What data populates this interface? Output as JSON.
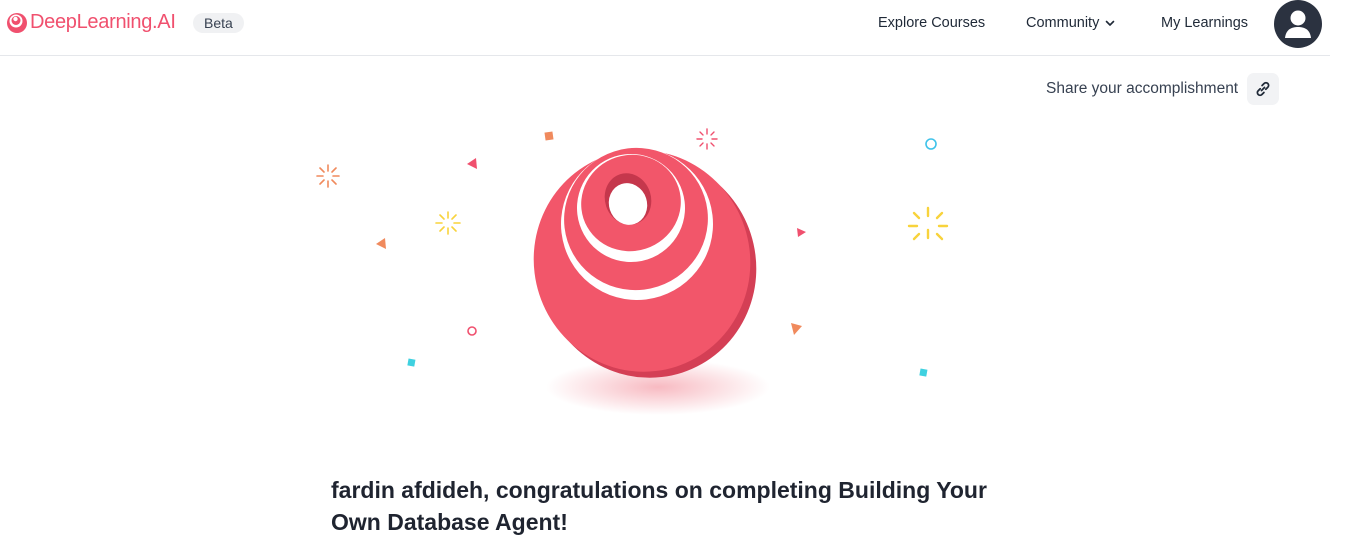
{
  "header": {
    "logo_text": "DeepLearning.AI",
    "logo_icon": "deeplearning-logo-icon",
    "beta_label": "Beta",
    "nav": {
      "explore_label": "Explore Courses",
      "community_label": "Community",
      "learnings_label": "My Learnings"
    },
    "avatar_icon": "user-avatar-icon"
  },
  "share": {
    "label": "Share your accomplishment",
    "icon": "link-icon"
  },
  "hero": {
    "icon": "deeplearning-badge-icon",
    "decorations": "confetti"
  },
  "main": {
    "congrats_text": "fardin afdideh, congratulations on completing Building Your Own Database Agent!"
  },
  "colors": {
    "brand": "#f0506e",
    "badge": "#f2566a",
    "avatar_bg": "#2b3240"
  }
}
